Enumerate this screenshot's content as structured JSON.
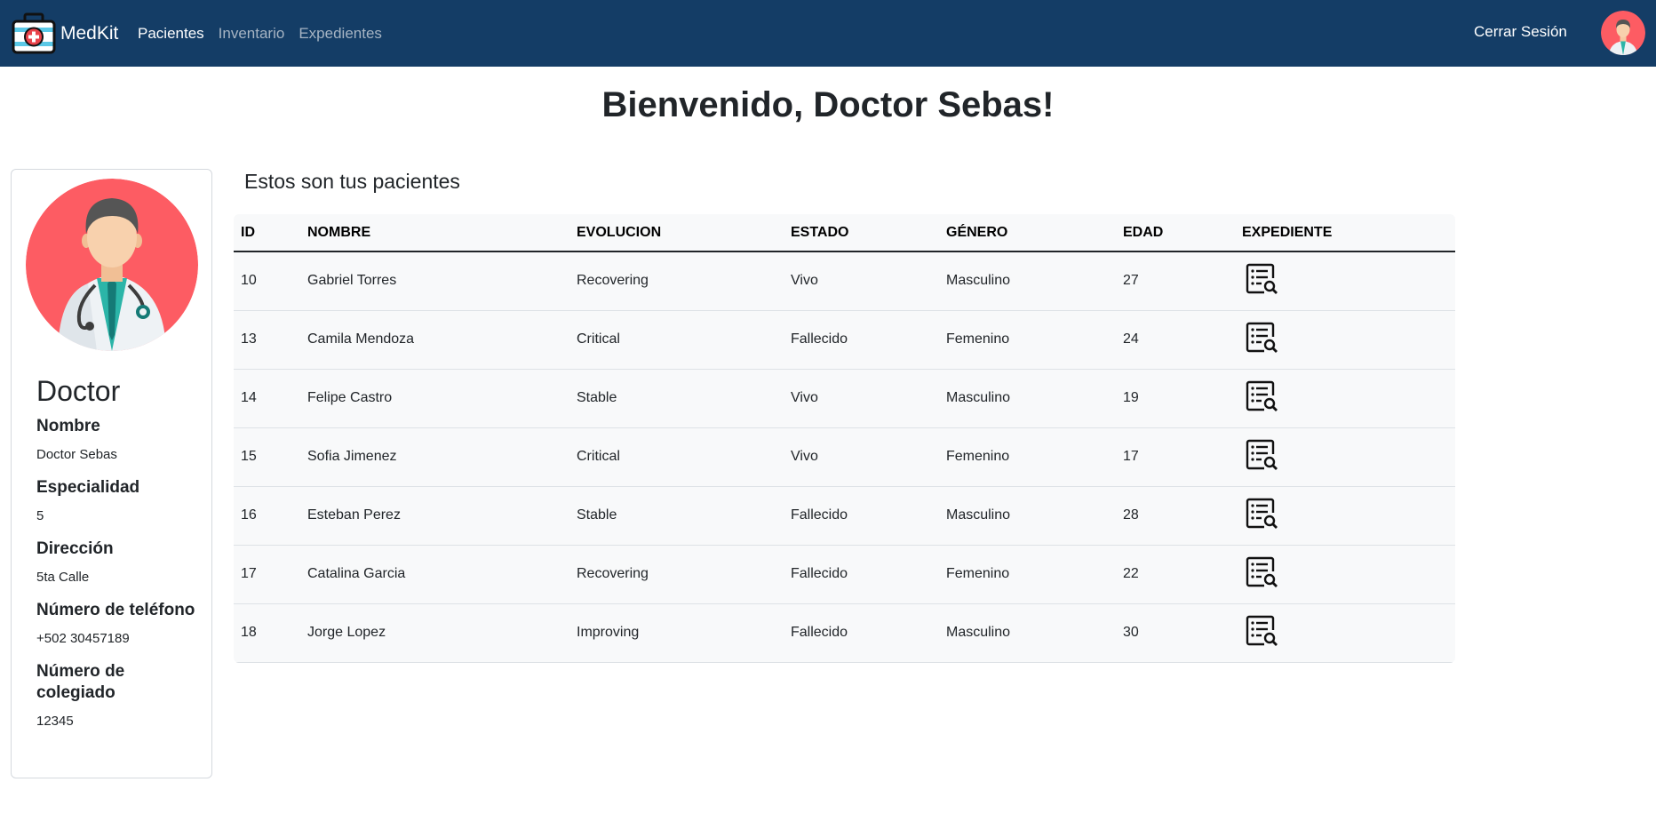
{
  "navbar": {
    "brand": "MedKit",
    "links": [
      {
        "label": "Pacientes",
        "active": true
      },
      {
        "label": "Inventario",
        "active": false
      },
      {
        "label": "Expedientes",
        "active": false
      }
    ],
    "logout_label": "Cerrar Sesión",
    "logo_icon": "medical-kit-icon",
    "avatar_icon": "doctor-avatar-icon",
    "background_color": "#143d66"
  },
  "page_title": "Bienvenido, Doctor Sebas!",
  "profile": {
    "heading": "Doctor",
    "fields": [
      {
        "label": "Nombre",
        "value": "Doctor Sebas"
      },
      {
        "label": "Especialidad",
        "value": "5"
      },
      {
        "label": "Dirección",
        "value": "5ta Calle"
      },
      {
        "label": "Número de teléfono",
        "value": "+502 30457189"
      },
      {
        "label": "Número de colegiado",
        "value": "12345"
      }
    ],
    "avatar_color": "#fd5c63"
  },
  "patients": {
    "title": "Estos son tus pacientes",
    "columns": [
      "ID",
      "NOMBRE",
      "EVOLUCION",
      "ESTADO",
      "GÉNERO",
      "EDAD",
      "EXPEDIENTE"
    ],
    "rows": [
      {
        "id": "10",
        "nombre": "Gabriel Torres",
        "evolucion": "Recovering",
        "estado": "Vivo",
        "genero": "Masculino",
        "edad": "27"
      },
      {
        "id": "13",
        "nombre": "Camila Mendoza",
        "evolucion": "Critical",
        "estado": "Fallecido",
        "genero": "Femenino",
        "edad": "24"
      },
      {
        "id": "14",
        "nombre": "Felipe Castro",
        "evolucion": "Stable",
        "estado": "Vivo",
        "genero": "Masculino",
        "edad": "19"
      },
      {
        "id": "15",
        "nombre": "Sofia Jimenez",
        "evolucion": "Critical",
        "estado": "Vivo",
        "genero": "Femenino",
        "edad": "17"
      },
      {
        "id": "16",
        "nombre": "Esteban Perez",
        "evolucion": "Stable",
        "estado": "Fallecido",
        "genero": "Masculino",
        "edad": "28"
      },
      {
        "id": "17",
        "nombre": "Catalina Garcia",
        "evolucion": "Recovering",
        "estado": "Fallecido",
        "genero": "Femenino",
        "edad": "22"
      },
      {
        "id": "18",
        "nombre": "Jorge Lopez",
        "evolucion": "Improving",
        "estado": "Fallecido",
        "genero": "Masculino",
        "edad": "30"
      }
    ],
    "record_icon": "medical-record-search-icon"
  }
}
